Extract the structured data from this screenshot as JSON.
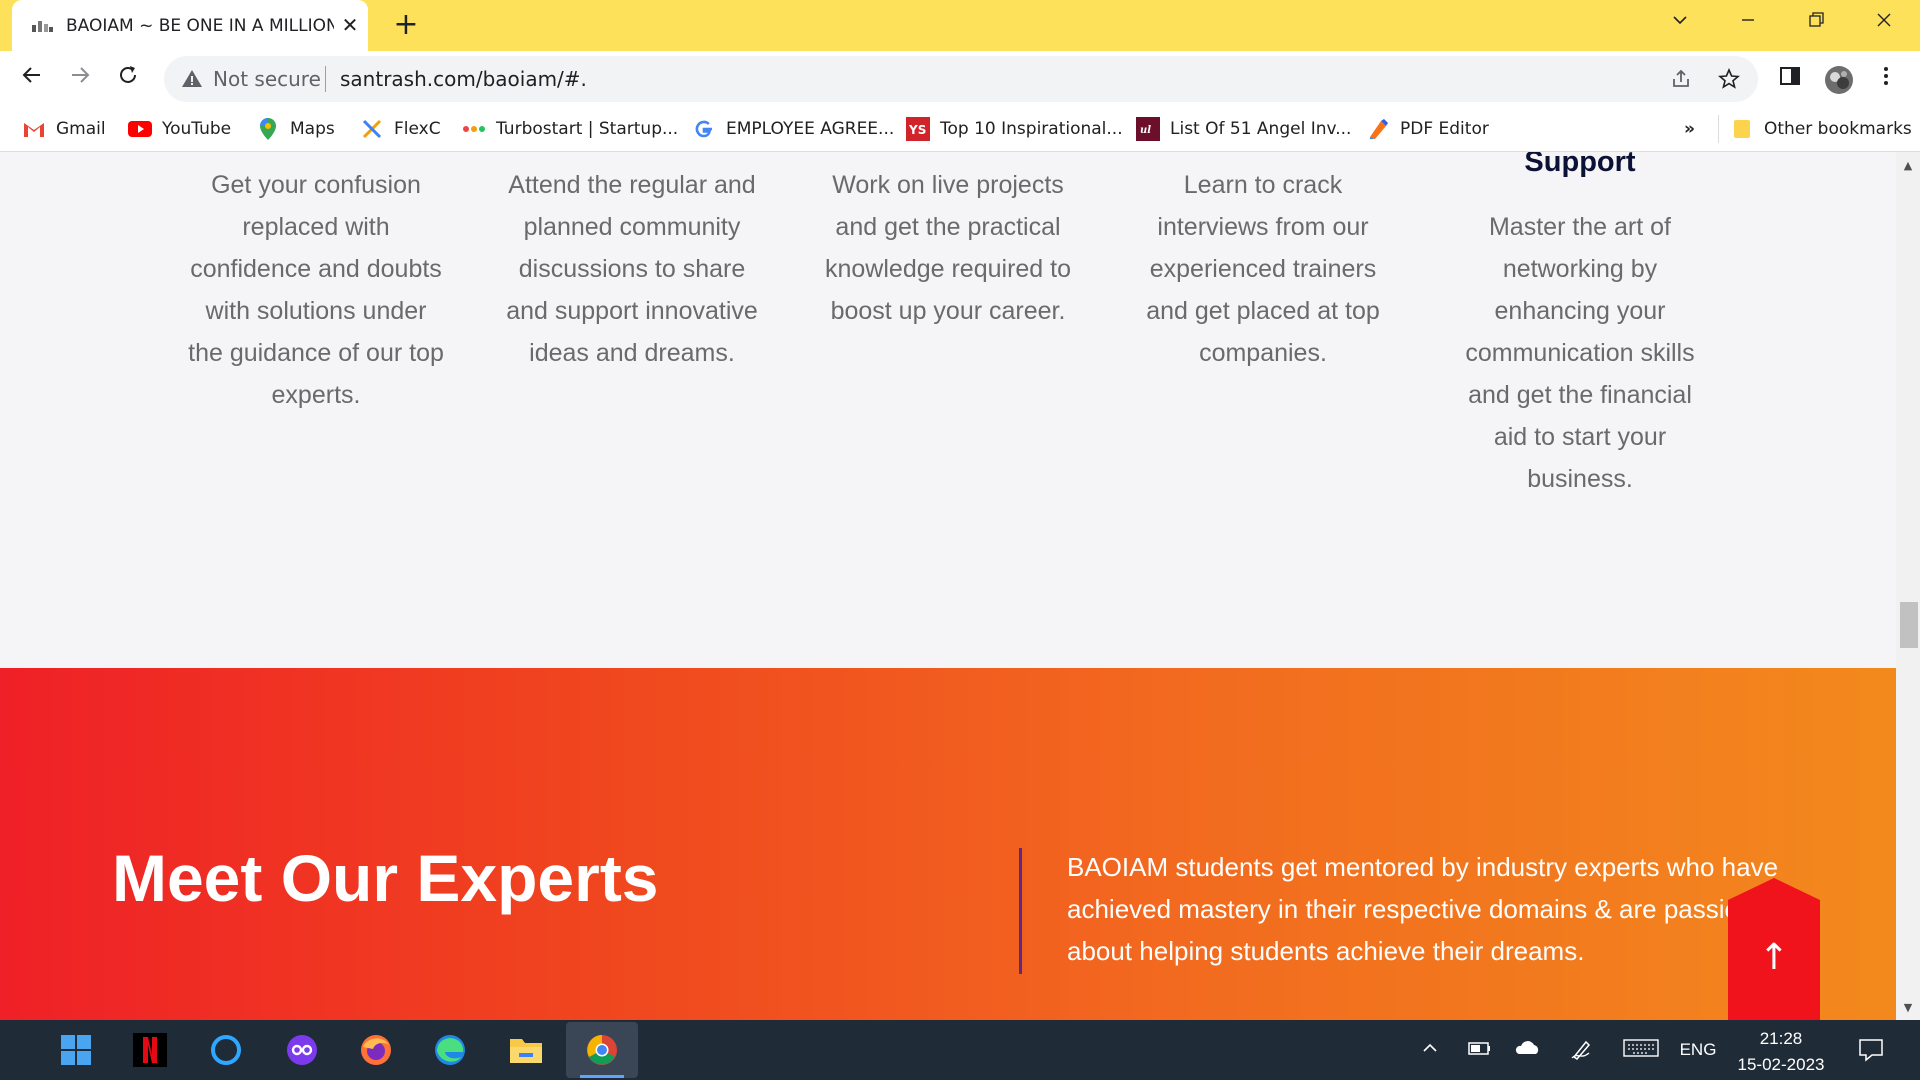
{
  "browser": {
    "tab": {
      "title": "BAOIAM ~ BE ONE IN A MILLION",
      "close": "✕"
    },
    "new_tab": "+",
    "window_controls": [
      "chevron-down",
      "minimize",
      "restore",
      "close"
    ],
    "address": {
      "security_label": "Not secure",
      "url": "santrash.com/baoiam/#."
    },
    "bookmarks": [
      {
        "label": "Gmail",
        "icon": "gmail-icon"
      },
      {
        "label": "YouTube",
        "icon": "youtube-icon"
      },
      {
        "label": "Maps",
        "icon": "maps-icon"
      },
      {
        "label": "FlexC",
        "icon": "flexc-icon"
      },
      {
        "label": "Turbostart | Startup...",
        "icon": "turbostart-icon"
      },
      {
        "label": "EMPLOYEE AGREE...",
        "icon": "google-icon"
      },
      {
        "label": "Top 10 Inspirational...",
        "icon": "ys-icon"
      },
      {
        "label": "List Of 51 Angel Inv...",
        "icon": "angel-icon"
      },
      {
        "label": "PDF Editor",
        "icon": "pdf-editor-icon"
      }
    ],
    "bookmarks_overflow": "»",
    "other_bookmarks": "Other bookmarks"
  },
  "features": [
    {
      "heading": "",
      "text": "Get your confusion replaced with confidence and doubts with solutions under the guidance of our top experts."
    },
    {
      "heading": "",
      "text": "Attend the regular and planned community discussions to share and support innovative ideas and dreams."
    },
    {
      "heading": "",
      "text": "Work on live projects and get the practical knowledge required to boost up your career."
    },
    {
      "heading": "",
      "text": "Learn to crack interviews from our experienced trainers and get placed at top companies."
    },
    {
      "heading": "Support",
      "text": "Master the art of networking by enhancing your communication skills and get the financial aid to start your business."
    }
  ],
  "experts": {
    "title": "Meet Our Experts",
    "description": "BAOIAM students get mentored by industry experts who have achieved mastery in their respective domains & are passionate about helping students achieve their dreams."
  },
  "back_to_top": "↑",
  "taskbar": {
    "apps": [
      "windows-start-icon",
      "netflix-icon",
      "cortana-icon",
      "game-bar-icon",
      "firefox-icon",
      "edge-icon",
      "file-explorer-icon",
      "chrome-icon"
    ],
    "language": "ENG",
    "time": "21:28",
    "date": "15-02-2023"
  },
  "colors": {
    "tabbar": "#fde15a",
    "gradient_start": "#ef2027",
    "gradient_end": "#f3891d",
    "heading_navy": "#0c1136",
    "body_text_grey": "#6a6a6a",
    "back_to_top_red": "#f1131c",
    "taskbar": "#202b38"
  }
}
